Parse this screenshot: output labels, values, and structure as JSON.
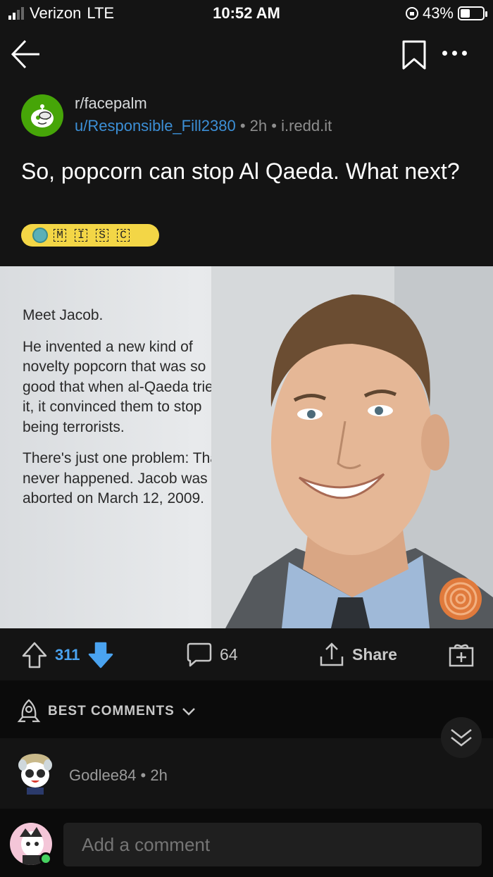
{
  "status_bar": {
    "carrier": "Verizon",
    "network": "LTE",
    "time": "10:52 AM",
    "battery": "43%",
    "battery_level": 0.43
  },
  "post": {
    "subreddit": "r/facepalm",
    "author": "u/Responsible_Fill2380",
    "age": "2h",
    "domain": "i.redd.it",
    "title": "So, popcorn can stop Al Qaeda. What next?",
    "flair": [
      "M",
      "I",
      "S",
      "C"
    ],
    "image_text": {
      "p1": "Meet Jacob.",
      "p2": "He invented a new kind of novelty popcorn that was so good that when al-Qaeda tried it, it convinced them to stop being terrorists.",
      "p3": "There's just one problem: That never happened. Jacob was aborted on March 12, 2009."
    }
  },
  "actions": {
    "votes": "311",
    "comments": "64",
    "share": "Share"
  },
  "comments_header": {
    "sort_label": "BEST COMMENTS"
  },
  "first_comment": {
    "user": "Godlee84",
    "age": "2h"
  },
  "composer": {
    "placeholder": "Add a comment"
  },
  "colors": {
    "background": "#141414",
    "link_blue": "#3c8fd6",
    "vote_blue": "#4aa3f0",
    "flair_yellow": "#f3d646",
    "subreddit_green": "#46a508"
  }
}
